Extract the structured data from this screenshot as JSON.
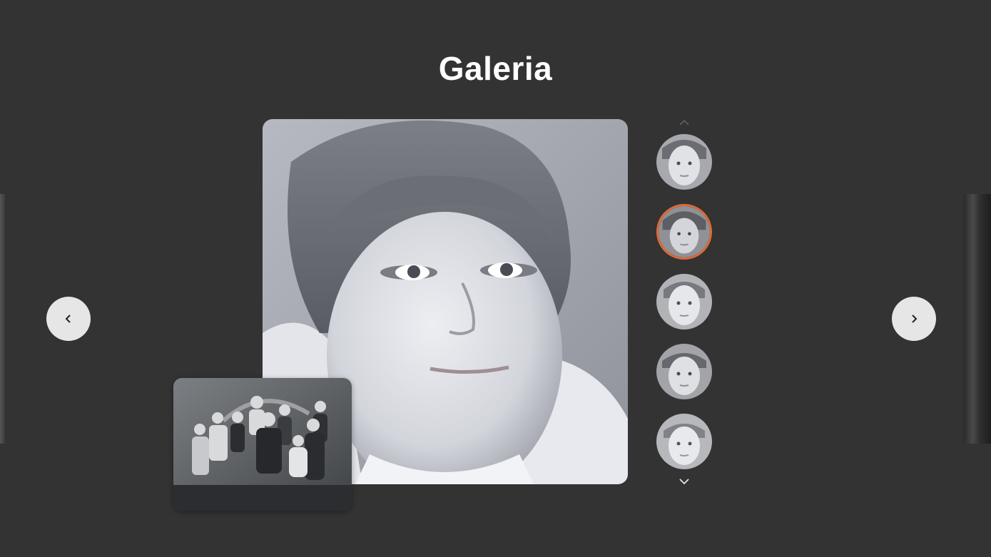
{
  "page": {
    "title": "Galeria"
  },
  "colors": {
    "background": "#333333",
    "title": "#ffffff",
    "nav_button": "#e6e6e6",
    "active_thumb_border": "#e06a35"
  },
  "icons": {
    "prev": "chevron-left-icon",
    "next": "chevron-right-icon",
    "thumbs_up": "chevron-up-icon",
    "thumbs_down": "chevron-down-icon"
  },
  "gallery": {
    "main_image": "portrait-photo",
    "secondary_image": "family-group-photo",
    "thumbnails": [
      {
        "active": false
      },
      {
        "active": true
      },
      {
        "active": false
      },
      {
        "active": false
      },
      {
        "active": false
      }
    ],
    "active_index": 1
  }
}
